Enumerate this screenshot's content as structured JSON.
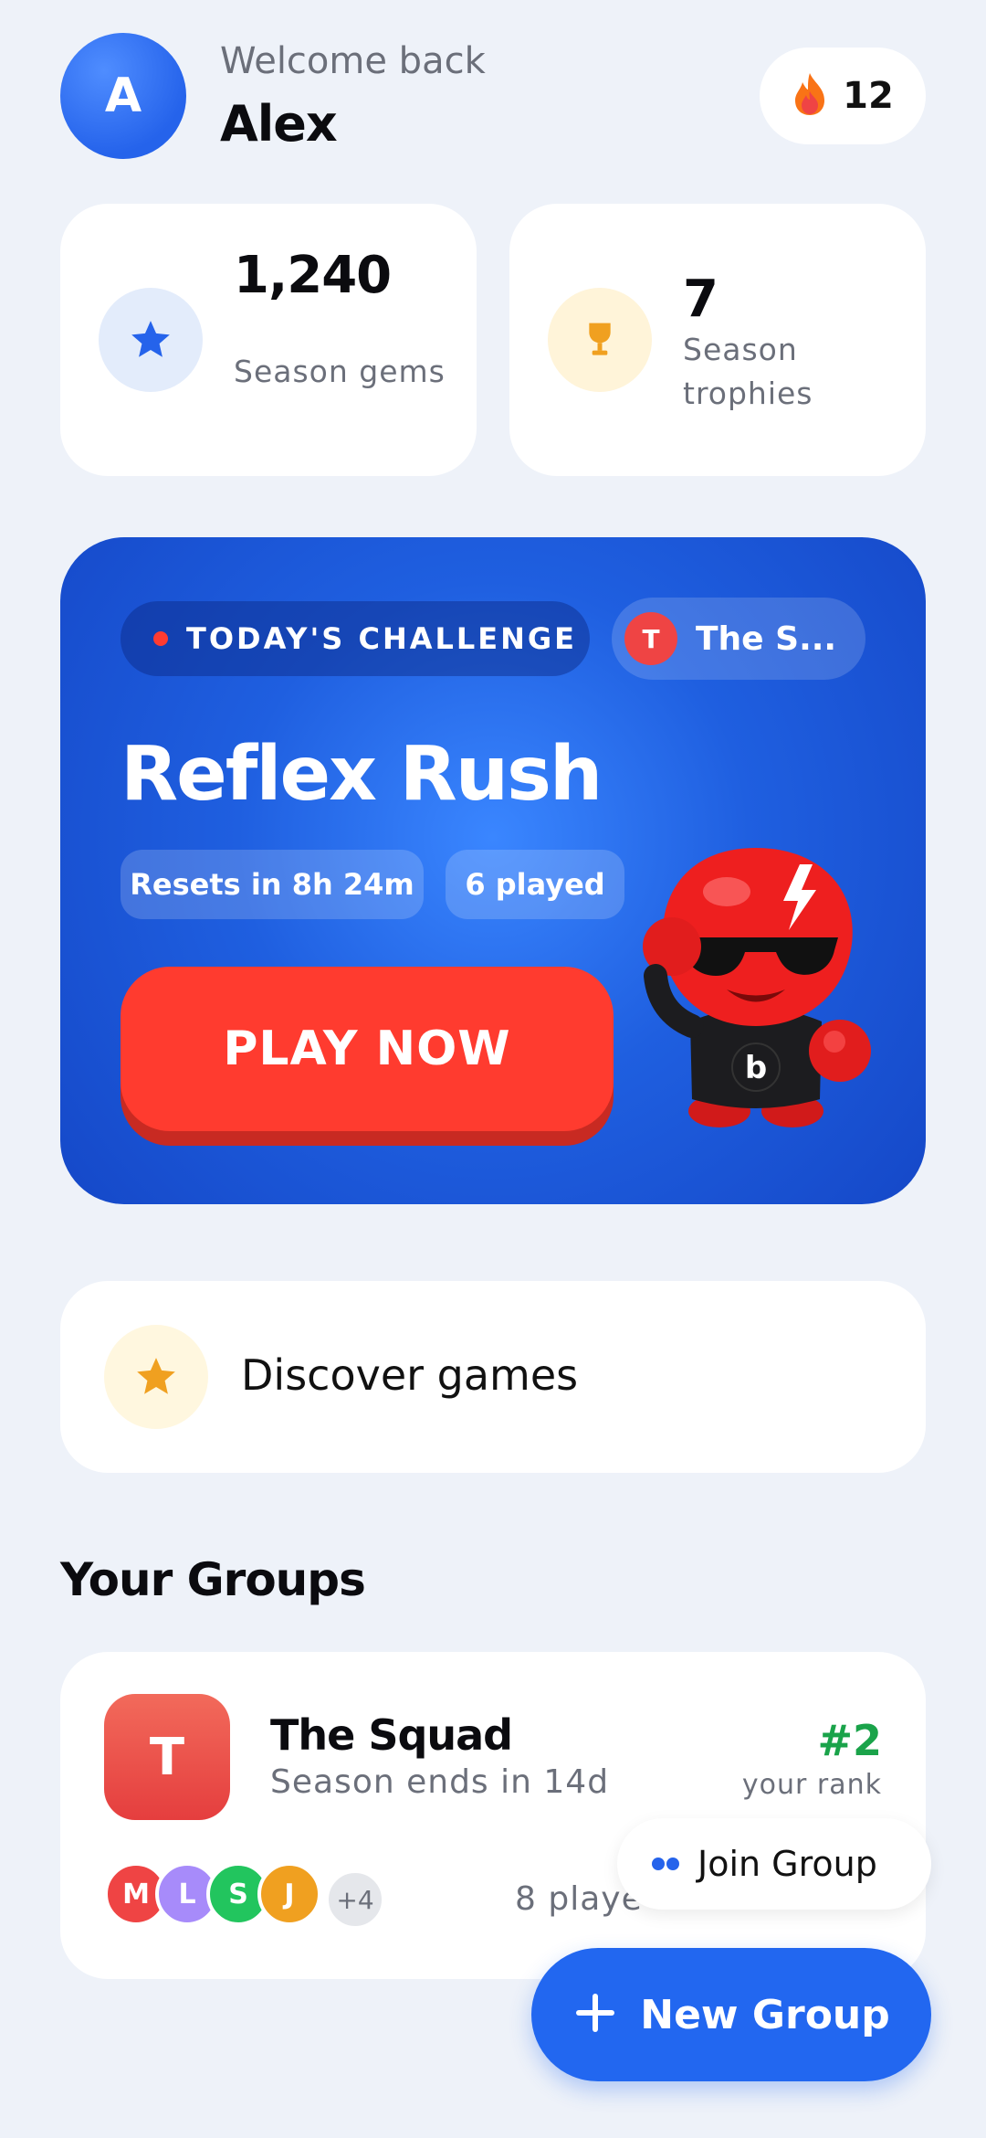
{
  "header": {
    "avatar_initial": "A",
    "welcome": "Welcome back",
    "username": "Alex",
    "streak_count": "12",
    "streak_icon": "flame-icon"
  },
  "stats": [
    {
      "value": "1,240",
      "label": "Season gems",
      "icon": "star-icon",
      "color": "#2563eb",
      "bg": "#e3ecfb"
    },
    {
      "value": "7",
      "label": "Season trophies",
      "icon": "trophy-icon",
      "color": "#f0a020",
      "bg": "#fff4d9"
    }
  ],
  "challenge": {
    "badge": "TODAY'S CHALLENGE",
    "group_initial": "T",
    "group_name": "The S...",
    "title": "Reflex Rush",
    "resets": "Resets in 8h 24m",
    "played": "6 played",
    "play_label": "PLAY NOW",
    "mascot_letter": "b"
  },
  "discover": {
    "label": "Discover games",
    "icon": "star-icon"
  },
  "groups_section": {
    "title": "Your Groups"
  },
  "groups": [
    {
      "initial": "T",
      "name": "The Squad",
      "subtitle": "Season ends in 14d",
      "rank": "#2",
      "rank_label": "your rank",
      "members": [
        {
          "initial": "M",
          "color": "#ef4444"
        },
        {
          "initial": "L",
          "color": "#a78bfa"
        },
        {
          "initial": "S",
          "color": "#22c55e"
        },
        {
          "initial": "J",
          "color": "#f0a020"
        },
        {
          "initial": "+4",
          "color": "#e5e7eb"
        }
      ],
      "played": "8 playe"
    }
  ],
  "actions": {
    "join_group": "Join Group",
    "new_group": "New Group"
  },
  "colors": {
    "background": "#eef2f9",
    "primary": "#2267f0",
    "play": "#ff3b2f",
    "rank": "#1aa34a"
  }
}
